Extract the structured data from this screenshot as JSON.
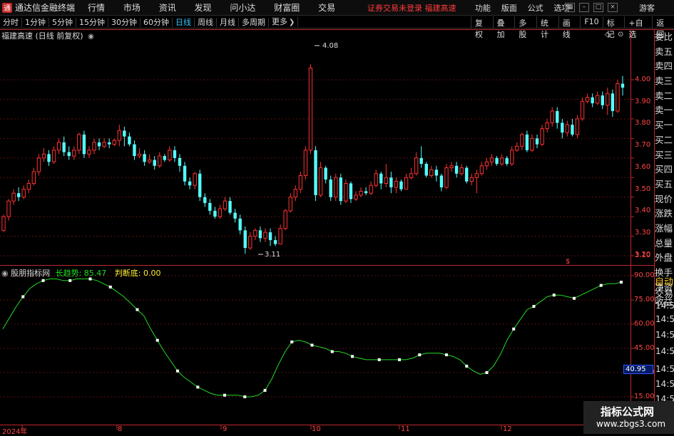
{
  "titlebar": {
    "app_name": "通达信金融终端",
    "menu": [
      "行情",
      "市场",
      "资讯",
      "发现",
      "问小达",
      "财富圈",
      "交易"
    ],
    "notice": "证券交易未登录   福建高速",
    "right_menu": [
      "功能",
      "版面",
      "公式",
      "选项"
    ],
    "guest": "游客"
  },
  "periods": [
    "分时",
    "1分钟",
    "5分钟",
    "15分钟",
    "30分钟",
    "60分钟",
    "日线",
    "周线",
    "月线",
    "多周期",
    "更多"
  ],
  "active_period": "日线",
  "toolbar_right": [
    "复权",
    "叠加",
    "多股",
    "统计",
    "画线",
    "F10",
    "标记",
    "+自选",
    "返回"
  ],
  "stock": {
    "name": "福建高速",
    "mode": "(日线 前复权)"
  },
  "price_axis": [
    "4.00",
    "3.90",
    "3.80",
    "3.70",
    "3.60",
    "3.50",
    "3.40",
    "3.30",
    "3.20",
    "3.10"
  ],
  "annotations": {
    "high": "4.08",
    "low": "3.11"
  },
  "indicator": {
    "name": "股朋指标网",
    "line1": "长趋势: 85.47",
    "line2": "判断底: 0.00",
    "current": "40.95"
  },
  "indicator_axis": [
    "90.00",
    "75.00",
    "60.00",
    "45.00",
    "30.00",
    "15.00"
  ],
  "x_labels": [
    "2024年",
    "8",
    "9",
    "10",
    "11",
    "12"
  ],
  "right_panel": [
    "委比",
    "卖五",
    "卖四",
    "卖三",
    "卖二",
    "卖一",
    "买一",
    "买二",
    "买三",
    "买四",
    "买五",
    "现价",
    "涨跌",
    "涨幅",
    "总量",
    "外盘",
    "换手",
    "净资",
    "收益"
  ],
  "right_tabs": [
    "自动",
    "交易"
  ],
  "time_labels": [
    "14:56",
    "14:56",
    "14:56",
    "14:56",
    "14:56",
    "14:56",
    "14:56"
  ],
  "right_header": "委比",
  "watermark": {
    "line1": "指标公式网",
    "line2": "www.zbgs3.com"
  },
  "colors": {
    "up": "#ff3232",
    "down": "#54ffff",
    "indicator_line": "#22dd22",
    "border": "#c0282d"
  },
  "chart_data": {
    "type": "candlestick",
    "ylim": [
      3.08,
      4.1
    ],
    "candles": [
      [
        3.23,
        3.3,
        3.31,
        3.22
      ],
      [
        3.3,
        3.38,
        3.39,
        3.28
      ],
      [
        3.38,
        3.42,
        3.44,
        3.36
      ],
      [
        3.42,
        3.4,
        3.45,
        3.38
      ],
      [
        3.4,
        3.44,
        3.46,
        3.39
      ],
      [
        3.44,
        3.47,
        3.49,
        3.42
      ],
      [
        3.47,
        3.53,
        3.55,
        3.46
      ],
      [
        3.53,
        3.6,
        3.62,
        3.51
      ],
      [
        3.6,
        3.62,
        3.65,
        3.58
      ],
      [
        3.62,
        3.58,
        3.64,
        3.56
      ],
      [
        3.58,
        3.64,
        3.66,
        3.57
      ],
      [
        3.64,
        3.68,
        3.7,
        3.62
      ],
      [
        3.68,
        3.63,
        3.71,
        3.61
      ],
      [
        3.63,
        3.61,
        3.66,
        3.59
      ],
      [
        3.61,
        3.64,
        3.66,
        3.59
      ],
      [
        3.64,
        3.72,
        3.73,
        3.62
      ],
      [
        3.72,
        3.62,
        3.74,
        3.6
      ],
      [
        3.62,
        3.64,
        3.66,
        3.6
      ],
      [
        3.64,
        3.68,
        3.7,
        3.62
      ],
      [
        3.68,
        3.66,
        3.7,
        3.64
      ],
      [
        3.66,
        3.68,
        3.7,
        3.65
      ],
      [
        3.68,
        3.67,
        3.7,
        3.65
      ],
      [
        3.67,
        3.69,
        3.7,
        3.66
      ],
      [
        3.69,
        3.74,
        3.77,
        3.66
      ],
      [
        3.74,
        3.71,
        3.76,
        3.66
      ],
      [
        3.71,
        3.67,
        3.73,
        3.66
      ],
      [
        3.67,
        3.61,
        3.69,
        3.59
      ],
      [
        3.61,
        3.62,
        3.65,
        3.6
      ],
      [
        3.62,
        3.58,
        3.64,
        3.56
      ],
      [
        3.58,
        3.59,
        3.62,
        3.57
      ],
      [
        3.59,
        3.56,
        3.61,
        3.54
      ],
      [
        3.56,
        3.61,
        3.63,
        3.55
      ],
      [
        3.61,
        3.59,
        3.62,
        3.58
      ],
      [
        3.59,
        3.64,
        3.66,
        3.58
      ],
      [
        3.64,
        3.6,
        3.66,
        3.58
      ],
      [
        3.6,
        3.56,
        3.62,
        3.53
      ],
      [
        3.56,
        3.48,
        3.58,
        3.46
      ],
      [
        3.48,
        3.46,
        3.5,
        3.44
      ],
      [
        3.46,
        3.52,
        3.53,
        3.44
      ],
      [
        3.52,
        3.4,
        3.54,
        3.38
      ],
      [
        3.4,
        3.37,
        3.42,
        3.35
      ],
      [
        3.37,
        3.33,
        3.39,
        3.31
      ],
      [
        3.33,
        3.3,
        3.35,
        3.29
      ],
      [
        3.3,
        3.34,
        3.36,
        3.29
      ],
      [
        3.34,
        3.38,
        3.4,
        3.33
      ],
      [
        3.38,
        3.32,
        3.4,
        3.31
      ],
      [
        3.32,
        3.29,
        3.34,
        3.27
      ],
      [
        3.29,
        3.23,
        3.31,
        3.21
      ],
      [
        3.23,
        3.14,
        3.25,
        3.11
      ],
      [
        3.14,
        3.2,
        3.22,
        3.13
      ],
      [
        3.2,
        3.23,
        3.24,
        3.18
      ],
      [
        3.23,
        3.19,
        3.25,
        3.17
      ],
      [
        3.19,
        3.22,
        3.24,
        3.17
      ],
      [
        3.22,
        3.18,
        3.24,
        3.15
      ],
      [
        3.18,
        3.16,
        3.2,
        3.15
      ],
      [
        3.16,
        3.24,
        3.26,
        3.16
      ],
      [
        3.24,
        3.33,
        3.34,
        3.23
      ],
      [
        3.33,
        3.4,
        3.42,
        3.32
      ],
      [
        3.4,
        3.44,
        3.46,
        3.38
      ],
      [
        3.44,
        3.51,
        3.53,
        3.42
      ],
      [
        3.51,
        3.64,
        3.66,
        3.49
      ],
      [
        3.64,
        4.06,
        4.08,
        3.62
      ],
      [
        3.64,
        3.41,
        3.66,
        3.38
      ],
      [
        3.41,
        3.55,
        3.58,
        3.4
      ],
      [
        3.55,
        3.49,
        3.56,
        3.47
      ],
      [
        3.49,
        3.4,
        3.51,
        3.38
      ],
      [
        3.4,
        3.5,
        3.52,
        3.38
      ],
      [
        3.5,
        3.38,
        3.52,
        3.36
      ],
      [
        3.38,
        3.47,
        3.49,
        3.37
      ],
      [
        3.47,
        3.39,
        3.48,
        3.37
      ],
      [
        3.39,
        3.41,
        3.43,
        3.38
      ],
      [
        3.41,
        3.43,
        3.45,
        3.4
      ],
      [
        3.43,
        3.42,
        3.45,
        3.41
      ],
      [
        3.42,
        3.46,
        3.48,
        3.41
      ],
      [
        3.46,
        3.52,
        3.54,
        3.45
      ],
      [
        3.52,
        3.47,
        3.53,
        3.44
      ],
      [
        3.47,
        3.5,
        3.57,
        3.45
      ],
      [
        3.5,
        3.45,
        3.53,
        3.42
      ],
      [
        3.45,
        3.48,
        3.5,
        3.42
      ],
      [
        3.48,
        3.44,
        3.49,
        3.43
      ],
      [
        3.44,
        3.5,
        3.52,
        3.44
      ],
      [
        3.5,
        3.52,
        3.55,
        3.49
      ],
      [
        3.52,
        3.6,
        3.63,
        3.51
      ],
      [
        3.6,
        3.57,
        3.66,
        3.55
      ],
      [
        3.57,
        3.51,
        3.58,
        3.5
      ],
      [
        3.51,
        3.54,
        3.56,
        3.5
      ],
      [
        3.54,
        3.51,
        3.56,
        3.48
      ],
      [
        3.51,
        3.45,
        3.52,
        3.43
      ],
      [
        3.45,
        3.55,
        3.57,
        3.44
      ],
      [
        3.55,
        3.56,
        3.58,
        3.53
      ],
      [
        3.56,
        3.52,
        3.58,
        3.5
      ],
      [
        3.52,
        3.55,
        3.57,
        3.51
      ],
      [
        3.55,
        3.48,
        3.56,
        3.47
      ],
      [
        3.48,
        3.5,
        3.52,
        3.46
      ],
      [
        3.5,
        3.52,
        3.54,
        3.42
      ],
      [
        3.52,
        3.56,
        3.58,
        3.51
      ],
      [
        3.56,
        3.58,
        3.6,
        3.54
      ],
      [
        3.58,
        3.6,
        3.62,
        3.56
      ],
      [
        3.6,
        3.57,
        3.61,
        3.56
      ],
      [
        3.57,
        3.6,
        3.62,
        3.56
      ],
      [
        3.6,
        3.57,
        3.61,
        3.56
      ],
      [
        3.57,
        3.64,
        3.66,
        3.56
      ],
      [
        3.64,
        3.66,
        3.68,
        3.63
      ],
      [
        3.66,
        3.72,
        3.73,
        3.64
      ],
      [
        3.72,
        3.64,
        3.74,
        3.63
      ],
      [
        3.64,
        3.7,
        3.72,
        3.63
      ],
      [
        3.7,
        3.67,
        3.72,
        3.65
      ],
      [
        3.67,
        3.75,
        3.77,
        3.66
      ],
      [
        3.75,
        3.78,
        3.8,
        3.73
      ],
      [
        3.78,
        3.84,
        3.86,
        3.76
      ],
      [
        3.84,
        3.78,
        3.86,
        3.75
      ],
      [
        3.78,
        3.73,
        3.8,
        3.7
      ],
      [
        3.73,
        3.77,
        3.79,
        3.71
      ],
      [
        3.77,
        3.72,
        3.8,
        3.71
      ],
      [
        3.72,
        3.8,
        3.82,
        3.7
      ],
      [
        3.8,
        3.89,
        3.91,
        3.79
      ],
      [
        3.89,
        3.91,
        3.93,
        3.88
      ],
      [
        3.91,
        3.88,
        3.93,
        3.86
      ],
      [
        3.88,
        3.92,
        3.94,
        3.87
      ],
      [
        3.92,
        3.87,
        3.94,
        3.85
      ],
      [
        3.87,
        3.93,
        3.96,
        3.82
      ],
      [
        3.93,
        3.84,
        3.95,
        3.81
      ],
      [
        3.84,
        3.98,
        4.0,
        3.83
      ],
      [
        3.98,
        3.96,
        4.02,
        3.92
      ]
    ],
    "indicator_values": [
      57,
      64,
      71,
      77,
      82,
      85,
      87,
      88,
      88,
      87,
      87,
      88,
      88,
      88,
      87,
      85,
      83,
      80,
      77,
      73,
      69,
      65,
      57,
      50,
      43,
      37,
      31,
      27,
      24,
      21,
      19,
      17,
      16,
      16,
      16,
      16,
      15,
      15,
      16,
      19,
      26,
      35,
      43,
      49,
      50,
      49,
      47,
      46,
      45,
      43,
      43,
      42,
      40,
      39,
      38,
      38,
      38,
      38,
      38,
      38,
      38,
      39,
      41,
      42,
      42,
      42,
      41,
      40,
      38,
      34,
      31,
      29,
      30,
      34,
      41,
      50,
      57,
      63,
      69,
      71,
      74,
      77,
      78,
      78,
      77,
      76,
      78,
      80,
      82,
      84,
      85,
      85,
      86
    ]
  }
}
